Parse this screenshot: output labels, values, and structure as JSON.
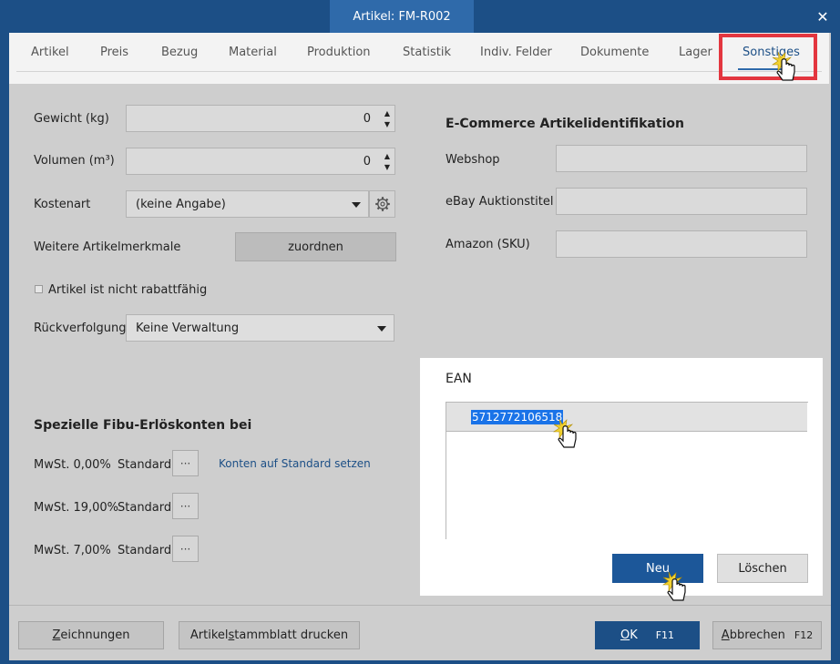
{
  "window": {
    "title": "Artikel: FM-R002",
    "close_glyph": "✕"
  },
  "tabs": [
    {
      "label": "Artikel"
    },
    {
      "label": "Preis"
    },
    {
      "label": "Bezug"
    },
    {
      "label": "Material"
    },
    {
      "label": "Produktion"
    },
    {
      "label": "Statistik"
    },
    {
      "label": "Indiv. Felder"
    },
    {
      "label": "Dokumente"
    },
    {
      "label": "Lager"
    },
    {
      "label": "Sonstiges",
      "active": true
    }
  ],
  "left": {
    "weight": {
      "label": "Gewicht (kg)",
      "value": "0"
    },
    "volume": {
      "label": "Volumen (m³)",
      "value": "0"
    },
    "cost_type": {
      "label": "Kostenart",
      "value": "(keine Angabe)"
    },
    "features": {
      "label": "Weitere Artikelmerkmale",
      "button": "zuordnen"
    },
    "no_discount": {
      "label": "Artikel ist nicht rabattfähig",
      "checked": false
    },
    "tracking": {
      "label": "Rückverfolgung",
      "value": "Keine Verwaltung"
    }
  },
  "fibu": {
    "heading": "Spezielle Fibu-Erlöskonten bei",
    "reset_link": "Konten auf Standard setzen",
    "rows": [
      {
        "label": "MwSt. 0,00%",
        "value": "Standard",
        "button": "···"
      },
      {
        "label": "MwSt. 19,00%",
        "value": "Standard",
        "button": "···"
      },
      {
        "label": "MwSt. 7,00%",
        "value": "Standard",
        "button": "···"
      }
    ]
  },
  "ecommerce": {
    "heading": "E-Commerce Artikelidentifikation",
    "webshop": {
      "label": "Webshop",
      "value": ""
    },
    "ebay": {
      "label": "eBay Auktionstitel",
      "value": ""
    },
    "amazon": {
      "label": "Amazon (SKU)",
      "value": ""
    }
  },
  "ean": {
    "heading": "EAN",
    "items": [
      "5712772106518"
    ],
    "new_button": "Neu",
    "delete_button": "Löschen"
  },
  "footer": {
    "drawings": {
      "label": "Zeichnungen",
      "underline": "Z",
      "rest": "eichnungen"
    },
    "print": {
      "pre": "Artikel",
      "underline": "s",
      "rest": "tammblatt drucken"
    },
    "ok": {
      "underline": "O",
      "rest": "K",
      "key": "F11"
    },
    "cancel": {
      "underline": "A",
      "rest": "bbrechen",
      "key": "F12"
    }
  },
  "colors": {
    "accent": "#1c4f86",
    "highlight": "#e3363f",
    "selection": "#1a73e8"
  }
}
